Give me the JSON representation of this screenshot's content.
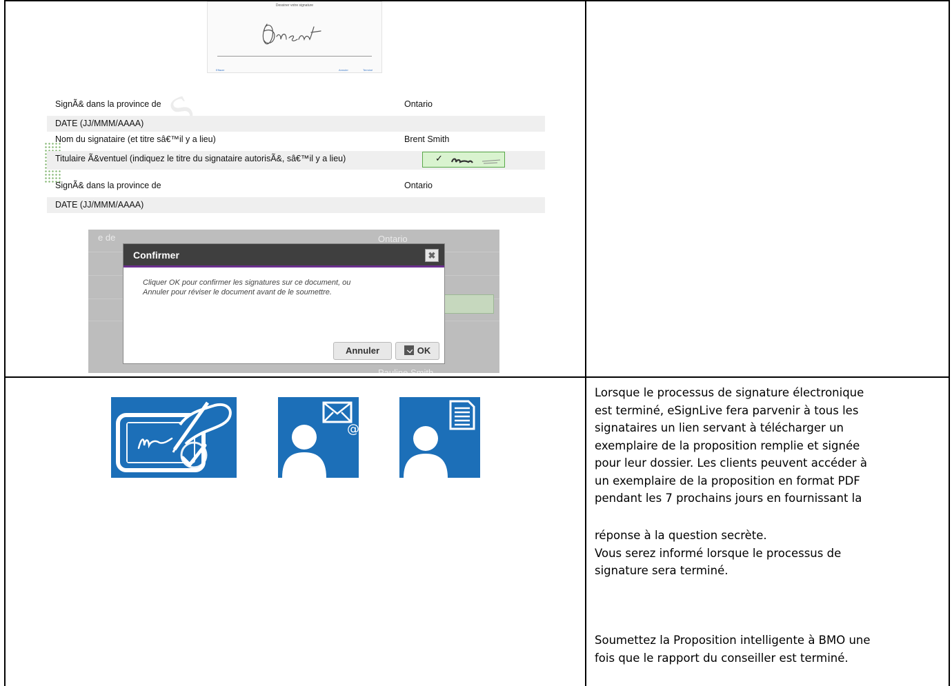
{
  "signature_pad": {
    "title": "Dessiner votre signature",
    "buttons": [
      "Effacer",
      "Annuler",
      "Terminé"
    ]
  },
  "form": {
    "watermark": "S",
    "rows": [
      {
        "label": "SignÃ& dans la province de",
        "value": "Ontario"
      },
      {
        "label": "DATE (JJ/MMM/AAAA)",
        "value": ""
      },
      {
        "label": "Nom du signataire (et titre sâ€™il y a lieu)",
        "value": "Brent Smith"
      },
      {
        "label": "Titulaire Ã&ventuel (indiquez le titre du signataire autorisÃ&, sâ€™il y a lieu)",
        "value": ""
      },
      {
        "label": "SignÃ& dans la province de",
        "value": "Ontario"
      },
      {
        "label": "DATE (JJ/MMM/AAAA)",
        "value": ""
      }
    ],
    "signed_check": "✓"
  },
  "dialog_screenshot": {
    "bg_left_text": "e de",
    "bg_right_text": "Ontario",
    "bg_bottom_text": "Pauline Smith",
    "dialog": {
      "title": "Confirmer",
      "close_symbol": "✖",
      "message_line1": "Cliquer OK pour confirmer les signatures sur ce document, ou",
      "message_line2": "Annuler pour réviser le document avant de le soumettre.",
      "cancel_label": "Annuler",
      "ok_label": "OK"
    }
  },
  "icons": [
    "sign-tablet-icon",
    "user-email-icon",
    "user-document-icon"
  ],
  "colors": {
    "icon_blue": "#1c6fb8",
    "dialog_accent": "#6b2f8f",
    "signed_green": "#d9f3cf"
  },
  "right_text": {
    "paragraph1": [
      "Lorsque le processus de signature électronique",
      "est terminé, eSignLive fera parvenir à tous les",
      "signataires un lien servant à télécharger un",
      "exemplaire de la proposition remplie et signée",
      "pour leur dossier. Les clients peuvent accéder à",
      "un exemplaire de la proposition en format PDF",
      "pendant les 7 prochains jours en fournissant la"
    ],
    "paragraph2": [
      "réponse à la question secrète.",
      "Vous serez informé lorsque le processus de",
      "signature sera terminé."
    ],
    "paragraph3": [
      "Soumettez la Proposition intelligente à BMO une",
      "fois que le rapport du conseiller est terminé."
    ]
  }
}
